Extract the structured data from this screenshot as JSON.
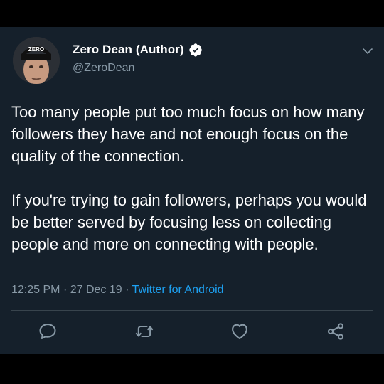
{
  "tweet": {
    "author_name": "Zero Dean (Author)",
    "handle": "@ZeroDean",
    "paragraphs": [
      "Too many people put too much focus on how many followers they have and not enough focus on the quality of the connection.",
      "If you're trying to gain followers, perhaps you would be better served by focusing less on collecting people and more on connecting with people."
    ],
    "time": "12:25 PM",
    "sep1": "·",
    "date": "27 Dec 19",
    "sep2": "·",
    "source": "Twitter for Android",
    "avatar_cap_text": "ZERO"
  },
  "icons": {
    "verified": "verified-badge-icon",
    "more": "chevron-down-icon",
    "reply": "comment-icon",
    "retweet": "retweet-icon",
    "like": "heart-icon",
    "share": "share-icon"
  },
  "colors": {
    "background": "#15202b",
    "text": "#ffffff",
    "muted": "#8899a6",
    "link": "#1da1f2"
  }
}
